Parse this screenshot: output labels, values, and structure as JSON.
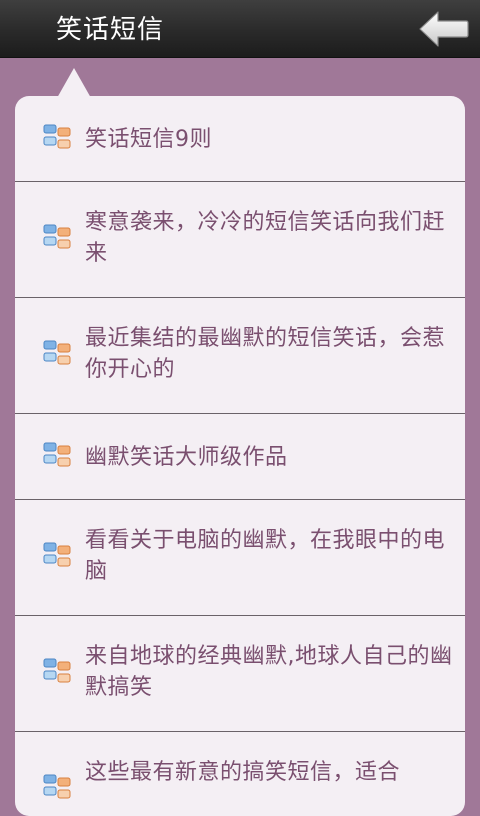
{
  "header": {
    "title": "笑话短信"
  },
  "list": {
    "items": [
      {
        "label": "笑话短信9则"
      },
      {
        "label": "寒意袭来，冷冷的短信笑话向我们赶来"
      },
      {
        "label": "最近集结的最幽默的短信笑话，会惹你开心的"
      },
      {
        "label": "幽默笑话大师级作品"
      },
      {
        "label": "看看关于电脑的幽默，在我眼中的电脑"
      },
      {
        "label": "来自地球的经典幽默,地球人自己的幽默搞笑"
      },
      {
        "label": "这些最有新意的搞笑短信，适合"
      }
    ]
  },
  "colors": {
    "background": "#a07898",
    "panel": "#f4eff4",
    "header": "#2a2a2a",
    "text": "#7a4f6f",
    "divider": "#6a6268"
  },
  "icons": {
    "back": "back-arrow-icon",
    "item": "list-item-icon"
  }
}
